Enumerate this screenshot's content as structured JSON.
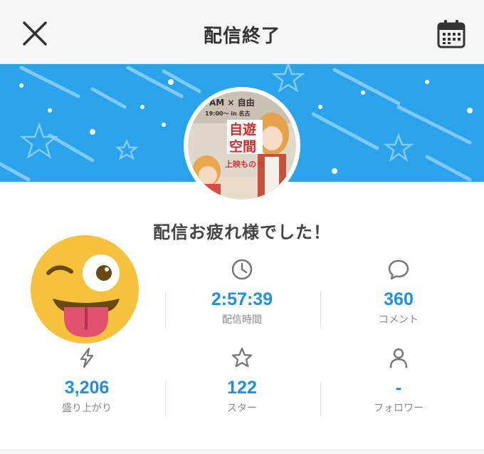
{
  "header": {
    "title": "配信終了",
    "close_icon": "close-icon",
    "calendar_icon": "calendar-icon"
  },
  "banner": {
    "color": "#2aa3ea",
    "thumbnail_text": [
      "自遊",
      "空間",
      "AM × 自由",
      "上映ものっ",
      "19:00〜 in 名古"
    ]
  },
  "greeting": "配信お疲れ様でした！",
  "avatar_icon": "winking-tongue-emoji",
  "stats": [
    {
      "id": "duration",
      "icon": "clock-icon",
      "value": "2:57:39",
      "label": "配信時間"
    },
    {
      "id": "comments",
      "icon": "comment-icon",
      "value": "360",
      "label": "コメント"
    },
    {
      "id": "excitement",
      "icon": "lightning-icon",
      "value": "3,206",
      "label": "盛り上がり"
    },
    {
      "id": "stars",
      "icon": "star-icon",
      "value": "122",
      "label": "スター"
    },
    {
      "id": "followers",
      "icon": "person-icon",
      "value": "-",
      "label": "フォロワー"
    }
  ],
  "colors": {
    "accent": "#1f8fe6",
    "label": "#888888",
    "icon": "#777777"
  }
}
